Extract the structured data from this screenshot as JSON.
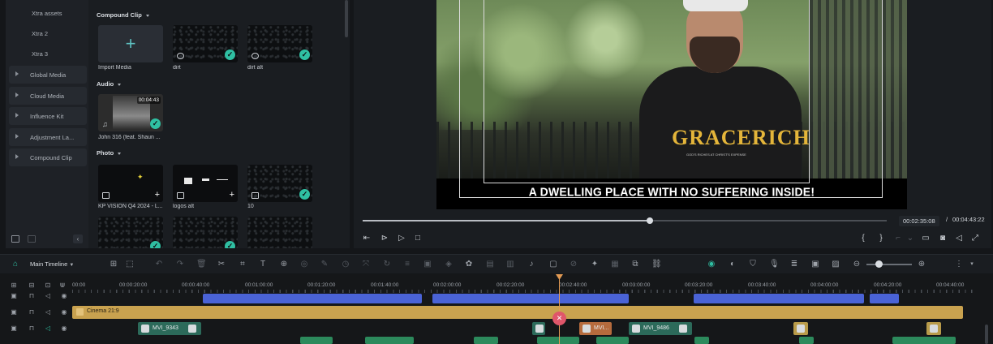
{
  "sidebar": {
    "items": [
      {
        "label": "Xtra assets"
      },
      {
        "label": "Xtra 2"
      },
      {
        "label": "Xtra 3"
      },
      {
        "label": "Global Media"
      },
      {
        "label": "Cloud Media"
      },
      {
        "label": "Influence Kit"
      },
      {
        "label": "Adjustment La..."
      },
      {
        "label": "Compound Clip"
      }
    ]
  },
  "media": {
    "sections": {
      "compound": "Compound Clip",
      "audio": "Audio",
      "photo": "Photo"
    },
    "compound_items": [
      {
        "label": "Import Media"
      },
      {
        "label": "dirt"
      },
      {
        "label": "dirt alt"
      }
    ],
    "audio_items": [
      {
        "label": "John 316 (feat. Shaun ...",
        "duration": "00:04:43"
      }
    ],
    "photo_items": [
      {
        "label": "KP VISION Q4 2024 - L..."
      },
      {
        "label": "logos alt"
      },
      {
        "label": "10"
      }
    ]
  },
  "preview": {
    "caption": "A DWELLING PLACE WITH NO SUFFERING INSIDE!",
    "shirt_text": "GRACERICH",
    "shirt_sub": "GOD'S RICHES AT CHRIST'S EXPENSE",
    "current_time": "00:02:35:08",
    "separator": "/",
    "total_time": "00:04:43:22",
    "progress": 0.548
  },
  "toolbar": {
    "timeline_label": "Main Timeline"
  },
  "timeline": {
    "ticks": [
      "00:00",
      "00:00:20:00",
      "00:00:40:00",
      "00:01:00:00",
      "00:01:20:00",
      "00:01:40:00",
      "00:02:00:00",
      "00:02:20:00",
      "00:02:40:00",
      "00:03:00:00",
      "00:03:20:00",
      "00:03:40:00",
      "00:04:00:00",
      "00:04:20:00",
      "00:04:40:00"
    ],
    "cinema_label": "Cinema 21:9",
    "clips": [
      {
        "label": "MVI_9343"
      },
      {
        "label": "MVI..."
      },
      {
        "label": "MVI_9486"
      }
    ]
  },
  "colors": {
    "accent": "#2fbfa2",
    "audio": "#4a63d6",
    "cinema": "#c9a24f",
    "playhead": "#e29a53"
  }
}
